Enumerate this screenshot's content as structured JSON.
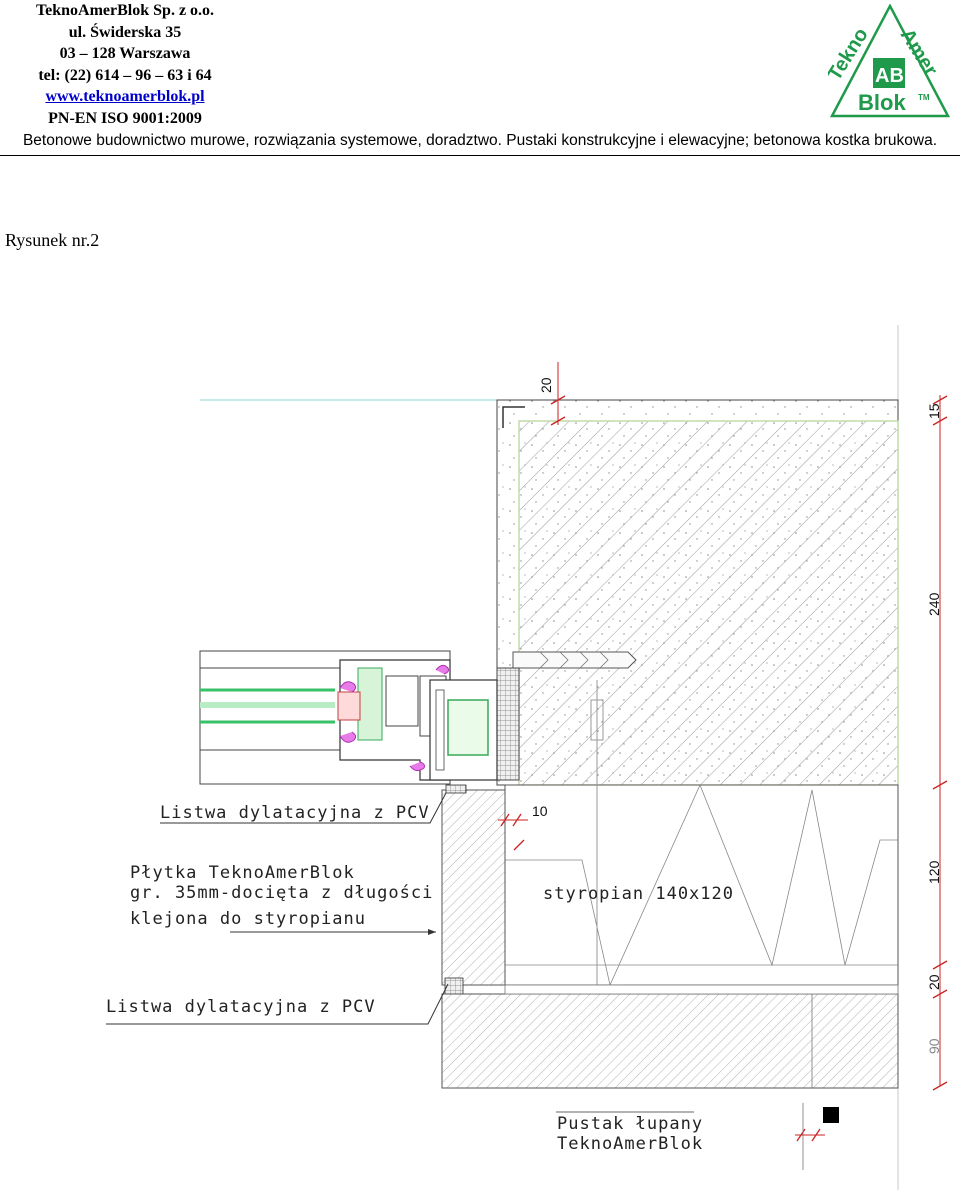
{
  "header": {
    "company_name": "TeknoAmerBlok Sp. z o.o.",
    "street": "ul. Świderska 35",
    "city": "03 – 128 Warszawa",
    "phone": "tel: (22) 614 – 96 – 63 i 64",
    "website": "www.teknoamerblok.pl",
    "certification": "PN-EN ISO 9001:2009",
    "tagline": "Betonowe budownictwo murowe, rozwiązania systemowe, doradztwo. Pustaki konstrukcyjne i elewacyjne; betonowa kostka brukowa."
  },
  "logo": {
    "word_top_left": "Tekno",
    "word_top_right": "Amer",
    "word_bottom": "Blok",
    "trademark": "TM",
    "monogram": "AB",
    "colors": {
      "green": "#1f9a4a",
      "red": "#d42a2a",
      "dark_green": "#0f6b2e"
    }
  },
  "figure": {
    "label": "Rysunek nr.2",
    "annotations": {
      "listwa_top": "Listwa dylatacyjna z PCV",
      "plytka_line1": "Płytka TeknoAmerBlok",
      "plytka_line2": "gr. 35mm-docięta z długości",
      "plytka_line3": "klejona do styropianu",
      "styropian": "styropian 140x120",
      "listwa_bottom": "Listwa dylatacyjna z PCV",
      "pustak_line1": "Pustak łupany",
      "pustak_line2": "TeknoAmerBlok"
    },
    "dimensions": {
      "top_20": "20",
      "right_15": "15",
      "right_240": "240",
      "gap_10": "10",
      "right_120": "120",
      "right_20": "20",
      "right_90": "90"
    }
  }
}
